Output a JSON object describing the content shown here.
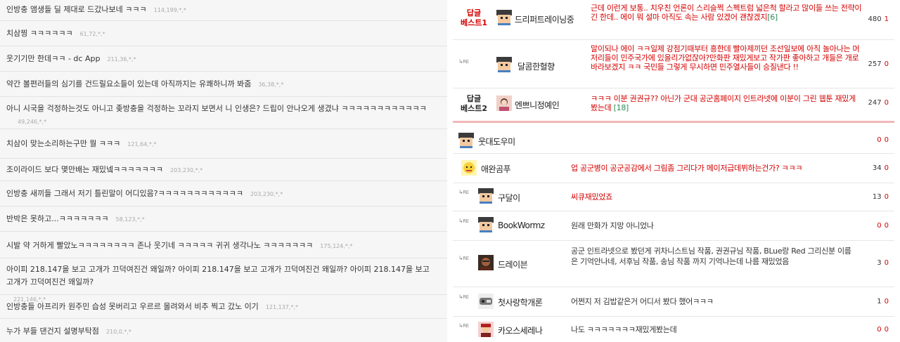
{
  "left_comments": [
    {
      "text": "인방충 앰생들 딜 제대로 드갔나보네 ㅋㅋㅋ",
      "ip": "114,199,*,*"
    },
    {
      "text": "치삼찡 ㅋㅋㅋㅋㅋㅋ",
      "ip": "61,72,*,*"
    },
    {
      "text": "웃기기만 한데ㅋㅋ - dc App",
      "ip": "211,36,*,*"
    },
    {
      "text": "약간 볼편러들의 심기를 건드릴요소들이 있는데 아직까지는 유쾌하니까 봐줌",
      "ip": "36,38,*,*"
    },
    {
      "text": "아니 시국을 걱정하는것도 아니고 좆방충을 걱정하는 꼬라지 보면서 니 인생은? 드립이 안나오게 생겼냐 ㅋㅋㅋㅋㅋㅋㅋㅋㅋㅋㅋㅋ",
      "ip": "49,246,*,*"
    },
    {
      "text": "치삼이 맞는소리하는구만 뭘 ㅋㅋㅋ",
      "ip": "121,64,*,*"
    },
    {
      "text": "조이라이드 보다 몇만배는 재밌넼ㅋㅋㅋㅋㅋㅋㅋ",
      "ip": "203,230,*,*"
    },
    {
      "text": "인방충 새끼들 그래서 저기 틀린말이 어디있음?ㅋㅋㅋㅋㅋㅋㅋㅋㅋㅋㅋㅋ",
      "ip": "203,230,*,*"
    },
    {
      "text": "반박은 못하고...ㅋㅋㅋㅋㅋㅋㅋ",
      "ip": "58,123,*,*"
    },
    {
      "text": "시발 약 거하게 빨았노ㅋㅋㅋㅋㅋㅋㅋㅋ 존나 웃기네 ㅋㅋㅋㅋㅋ 귀귀 생각나노 ㅋㅋㅋㅋㅋㅋㅋ",
      "ip": "175,124,*,*"
    },
    {
      "text": "아이피 218.147을 보고 고개가 끄덕여진건 왜일까? 아이피 218.147을 보고 고개가 끄덕여진건 왜일까? 아이피 218.147을 보고 고개가 끄덕여진건 왜일까?",
      "ip": "221,146,*,*"
    },
    {
      "text": "인방충들 아프리카 원주민 습성 못버리고 우르르 몰려와서 비추 찍고 갔노 이기",
      "ip": "121,137,*,*"
    },
    {
      "text": "누가 부들 댄건지 설명부탁점",
      "ip": "210,0,*,*"
    }
  ],
  "best": [
    {
      "badge": "답글\n베스트1",
      "nick": "드리퍼트레이닝중",
      "text": "근데 이런게 보통.. 치우친 언론이 스리슬쩍 스펙트럼 넓은척 할라고 많이들 쓰는 전략이긴 한데.. 에이 뭐 설마 아직도 속는 사람 있겠어 괜찮겠지",
      "count": "[6]",
      "up": "480",
      "down": "1"
    },
    {
      "badge": "",
      "nick": "달콤한혈향",
      "text": "말이되나 에이 ㅋㅋ일제 강점기때부터 흥한데 빨아제끼던 조선일보에 아직 놀아나는 머저리들이 민주국가에 있을리가없잖아?만화판 재밌게보고 작가판 좋아하고 개들은 개로 바라보겠지 ㅋㅋ 국민들 그렇게 무시하면 민주열사들이 승질낸다 !!",
      "count": "",
      "up": "257",
      "down": "0"
    },
    {
      "badge": "답글\n베스트2",
      "nick": "엔쁘니정예인",
      "text": "ㅋㅋㅋ 이분 권권규?? 아닌가 군대 공군홈페이지 인트라넷에 이분이 그린 웹툰 재밌게 봤는데",
      "count": "[18]",
      "up": "247",
      "down": "0"
    }
  ],
  "re_label": "RE",
  "replies": [
    {
      "is_re": false,
      "nick": "웃대도우미",
      "text": "",
      "red": false,
      "up": "0",
      "down": "0"
    },
    {
      "is_re": false,
      "nick": "애완곰푸",
      "text": "업 공군병이 공군공감에서 그림좀 그리다가 메이저급데뷔하는건가? ㅋㅋㅋ",
      "red": true,
      "up": "34",
      "down": "0"
    },
    {
      "is_re": true,
      "nick": "구달이",
      "text": "씨큐재밌었죠",
      "red": true,
      "up": "13",
      "down": "0"
    },
    {
      "is_re": true,
      "nick": "BookWormz",
      "text": "원래 만화가 지망 아니었나",
      "red": false,
      "up": "0",
      "down": "0"
    },
    {
      "is_re": true,
      "nick": "드레이븐",
      "text": "공군 인트라넷으로 봤던게 귀차니스트님 작품, 권권규님 작품, BLue랑 Red 그리신분 이름은 기억안나네, 서후님 작품, 송님 작품 까지 기억나는데 나름 재밌었음",
      "red": false,
      "up": "3",
      "down": "0"
    },
    {
      "is_re": true,
      "nick": "첫사랑학개론",
      "text": "어쩐지 저 김밥같은거 어디서 봤다 했어ㅋㅋㅋ",
      "red": false,
      "up": "1",
      "down": "0"
    },
    {
      "is_re": true,
      "nick": "카오스세레나",
      "text": "나도 ㅋㅋㅋㅋㅋㅋㅋ재밌게봤는데",
      "red": false,
      "up": "0",
      "down": "0"
    }
  ]
}
